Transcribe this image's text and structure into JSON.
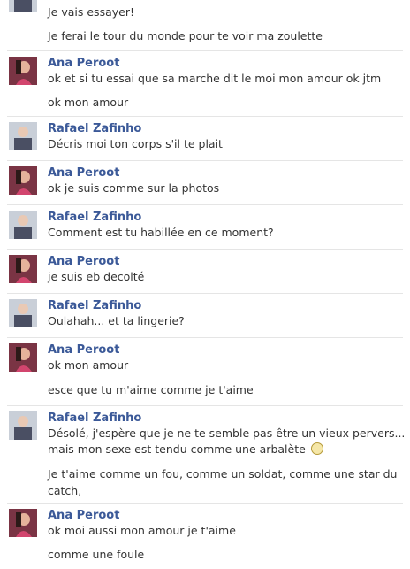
{
  "colors": {
    "name_blue": "#3b5998",
    "text_dark": "#333333",
    "separator": "#e5e5e5"
  },
  "conversation": [
    {
      "sender": "",
      "avatar_icon": "rafael-avatar-icon",
      "messages": [
        "Je vais essayer!",
        "Je ferai le tour du monde pour te voir ma zoulette"
      ]
    },
    {
      "sender": "Ana Peroot",
      "avatar_icon": "ana-avatar-icon",
      "messages": [
        "ok et si tu essai que sa marche dit le moi mon amour ok jtm",
        "ok mon amour"
      ]
    },
    {
      "sender": "Rafael Zafinho",
      "avatar_icon": "rafael-avatar-icon",
      "messages": [
        "Décris moi ton corps s'il te plait"
      ]
    },
    {
      "sender": "Ana Peroot",
      "avatar_icon": "ana-avatar-icon",
      "messages": [
        "ok je suis comme sur la photos"
      ]
    },
    {
      "sender": "Rafael Zafinho",
      "avatar_icon": "rafael-avatar-icon",
      "messages": [
        "Comment est tu habillée en ce moment?"
      ]
    },
    {
      "sender": "Ana Peroot",
      "avatar_icon": "ana-avatar-icon",
      "messages": [
        "je suis eb decolté"
      ]
    },
    {
      "sender": "Rafael Zafinho",
      "avatar_icon": "rafael-avatar-icon",
      "messages": [
        "Oulahah... et ta lingerie?"
      ]
    },
    {
      "sender": "Ana Peroot",
      "avatar_icon": "ana-avatar-icon",
      "messages": [
        "ok mon amour",
        "esce que tu m'aime comme je t'aime"
      ]
    },
    {
      "sender": "Rafael Zafinho",
      "avatar_icon": "rafael-avatar-icon",
      "messages": [
        "Désolé, j'espère que je ne te semble pas être un vieux pervers...",
        "mais mon sexe est tendu comme une arbalète",
        "Je t'aime comme un fou, comme un soldat, comme une star du",
        "catch,"
      ],
      "emoji_icon": "confused-emoji-icon"
    },
    {
      "sender": "Ana Peroot",
      "avatar_icon": "ana-avatar-icon",
      "messages": [
        "ok moi aussi mon amour je t'aime",
        "comme une foule"
      ]
    }
  ]
}
